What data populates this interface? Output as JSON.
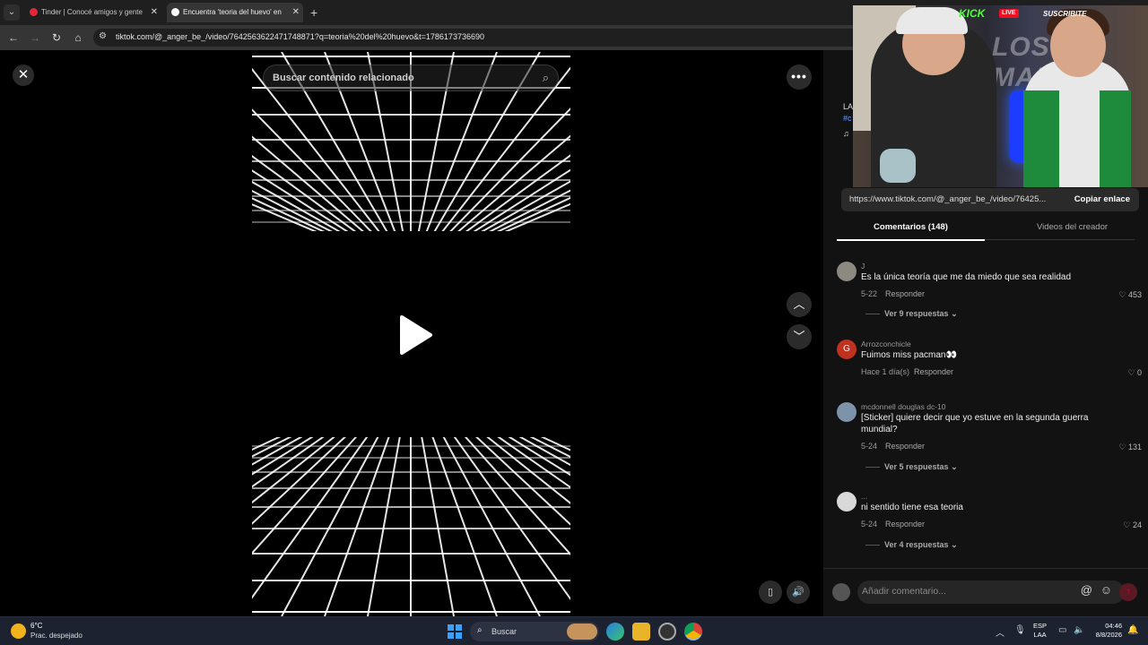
{
  "browser": {
    "tabs": [
      {
        "label": "Tinder | Conocé amigos y gente",
        "active": false
      },
      {
        "label": "Encuentra 'teoria del huevo' en",
        "active": true
      }
    ],
    "new_tab": "+",
    "url": "tiktok.com/@_anger_be_/video/7642563622471748871?q=teoria%20del%20huevo&t=1786173736690"
  },
  "video": {
    "search_placeholder": "Buscar contenido relacionado"
  },
  "panel": {
    "copy_url": "https://www.tiktok.com/@_anger_be_/video/76425...",
    "copy_button": "Copiar enlace",
    "tab_comments": "Comentarios (148)",
    "tab_creator": "Videos del creador",
    "comments": [
      {
        "user": "J",
        "text": "Es la única teoría que me da miedo que sea realidad",
        "date": "5-22",
        "reply": "Responder",
        "likes": "453",
        "more": "Ver 9 respuestas"
      },
      {
        "user": "Arrozconchicle",
        "text": "Fuimos miss pacman👀",
        "date": "Hace 1 día(s)",
        "reply": "Responder",
        "likes": "0",
        "more": ""
      },
      {
        "user": "mcdonnell douglas dc-10",
        "text": "[Sticker] quiere decir que yo estuve en la segunda guerra mundial?",
        "date": "5-24",
        "reply": "Responder",
        "likes": "131",
        "more": "Ver 5 respuestas"
      },
      {
        "user": "...",
        "text": "ni sentido tiene esa teoria",
        "date": "5-24",
        "reply": "Responder",
        "likes": "24",
        "more": "Ver 4 respuestas"
      }
    ],
    "comment_placeholder": "Añadir comentario...",
    "partial_text_1": "LA",
    "partial_text_2": "#c"
  },
  "stream": {
    "logo": "KICK",
    "live": "LIVE",
    "subscribe": "SUSCRIBITE",
    "bg_text": "LOS\nMARIN"
  },
  "taskbar": {
    "temp": "6°C",
    "weather": "Prac. despejado",
    "search": "Buscar",
    "lang_1": "ESP",
    "lang_2": "LAA",
    "time": "04:46",
    "date": "8/8/2026"
  }
}
